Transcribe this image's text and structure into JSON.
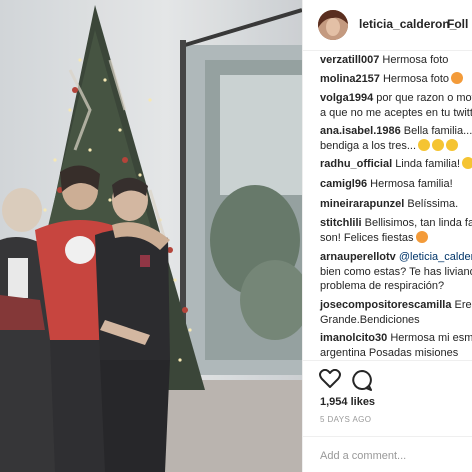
{
  "post": {
    "username": "leticia_calderon_",
    "follow_label": "Foll"
  },
  "comments": [
    {
      "user": "verzatill007",
      "lines": [
        "Hermosa foto"
      ]
    },
    {
      "user": "molina2157",
      "lines": [
        "Hermosa foto"
      ],
      "emoji": "heart-eyes"
    },
    {
      "user": "volga1994",
      "lines": [
        "por que razon o mot",
        "a que no me aceptes en tu twitt"
      ]
    },
    {
      "user": "ana.isabel.1986",
      "lines": [
        "Bella familia...di",
        "bendiga a los tres..."
      ],
      "emoji": "pensive-x3"
    },
    {
      "user": "radhu_official",
      "lines": [
        "Linda familia!"
      ],
      "emoji": "grin"
    },
    {
      "user": "camigl96",
      "lines": [
        "Hermosa familia!"
      ]
    },
    {
      "user": "mineirarapunzel",
      "lines": [
        "Belíssima."
      ]
    },
    {
      "user": "stitchlili",
      "lines": [
        "Bellisimos, tan linda fam",
        "son! Felices fiestas"
      ],
      "emoji": "kiss"
    },
    {
      "user": "arnauperellotv",
      "mention": "@leticia_calderon",
      "lines": [
        "",
        "bien como estas? Te has liviano",
        "problema de respiración?"
      ]
    },
    {
      "user": "josecompositorescamilla",
      "lines": [
        "Eres",
        "Grande.Bendiciones"
      ]
    },
    {
      "user": "imanolcito30",
      "lines": [
        "Hermosa mi esme",
        "argentina Posadas misiones"
      ]
    }
  ],
  "likes": "1,954 likes",
  "time_ago": "5 DAYS AGO",
  "add_comment_placeholder": "Add a comment...",
  "colors": {
    "text": "#262626",
    "muted": "#999999",
    "border": "#efefef",
    "mention": "#003569"
  },
  "icons": [
    "heart-outline-icon",
    "comment-icon"
  ]
}
